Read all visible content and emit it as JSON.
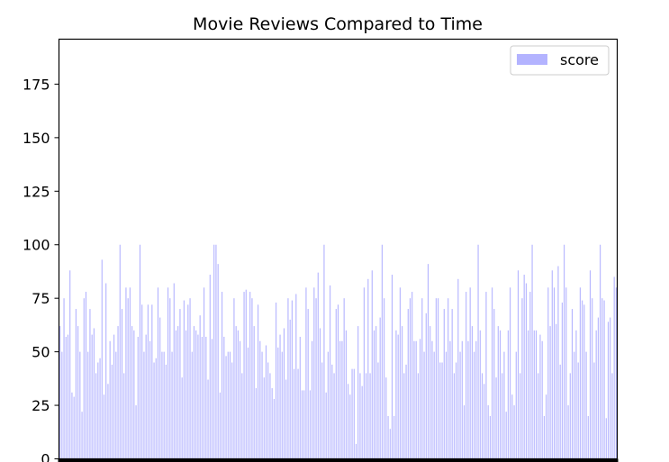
{
  "chart_data": {
    "type": "bar",
    "title": "Movie Reviews Compared to Time",
    "xlabel": "",
    "ylabel": "",
    "ylim": [
      0,
      196
    ],
    "yticks": [
      0,
      25,
      50,
      75,
      100,
      125,
      150,
      175
    ],
    "legend": {
      "position": "top-right"
    },
    "colors": {
      "bar": "#b3b3ff",
      "axis": "#000000",
      "background": "#ffffff"
    },
    "x_tick_labels_note": "",
    "series": [
      {
        "name": "score",
        "values": [
          62,
          50,
          75,
          57,
          58,
          88,
          31,
          29,
          70,
          62,
          50,
          22,
          75,
          78,
          50,
          70,
          58,
          61,
          40,
          45,
          47,
          93,
          30,
          82,
          35,
          55,
          44,
          58,
          50,
          62,
          100,
          70,
          40,
          80,
          75,
          80,
          62,
          60,
          25,
          57,
          100,
          72,
          50,
          58,
          72,
          55,
          72,
          45,
          47,
          80,
          66,
          50,
          50,
          44,
          80,
          75,
          50,
          82,
          60,
          62,
          70,
          38,
          74,
          60,
          72,
          75,
          50,
          62,
          60,
          58,
          67,
          57,
          80,
          57,
          37,
          86,
          56,
          100,
          100,
          91,
          31,
          78,
          57,
          48,
          50,
          50,
          45,
          75,
          62,
          60,
          55,
          40,
          78,
          79,
          52,
          78,
          75,
          62,
          33,
          72,
          55,
          50,
          38,
          53,
          45,
          40,
          33,
          28,
          73,
          52,
          58,
          50,
          61,
          37,
          75,
          65,
          74,
          42,
          77,
          42,
          57,
          32,
          32,
          80,
          70,
          32,
          55,
          80,
          75,
          87,
          61,
          45,
          100,
          31,
          50,
          81,
          44,
          40,
          70,
          72,
          55,
          55,
          75,
          60,
          35,
          30,
          42,
          42,
          7,
          62,
          40,
          34,
          80,
          40,
          84,
          40,
          88,
          60,
          62,
          45,
          66,
          100,
          75,
          38,
          20,
          14,
          86,
          20,
          60,
          58,
          80,
          62,
          40,
          44,
          70,
          75,
          78,
          55,
          55,
          40,
          56,
          75,
          50,
          68,
          91,
          62,
          55,
          50,
          75,
          75,
          45,
          45,
          70,
          50,
          75,
          55,
          70,
          40,
          45,
          84,
          50,
          55,
          25,
          78,
          55,
          80,
          62,
          50,
          55,
          100,
          60,
          40,
          35,
          78,
          25,
          20,
          80,
          70,
          38,
          62,
          60,
          40,
          50,
          22,
          60,
          80,
          30,
          25,
          50,
          88,
          40,
          75,
          86,
          82,
          60,
          78,
          100,
          60,
          60,
          40,
          58,
          55,
          20,
          30,
          80,
          62,
          88,
          80,
          63,
          90,
          44,
          73,
          100,
          80,
          25,
          40,
          70,
          50,
          60,
          45,
          80,
          74,
          72,
          50,
          20,
          88,
          75,
          45,
          60,
          66,
          100,
          75,
          74,
          19,
          64,
          66,
          40,
          85,
          80
        ]
      }
    ]
  }
}
